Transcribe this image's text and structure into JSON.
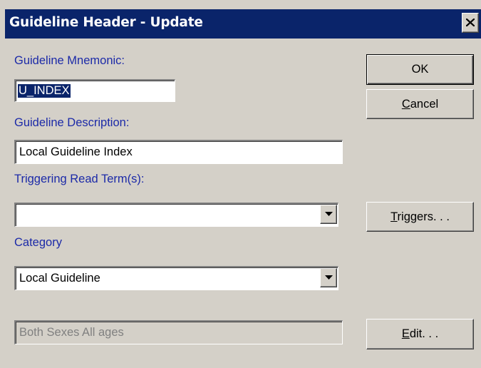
{
  "window": {
    "title": "Guideline Header - Update"
  },
  "fields": {
    "mnemonic_label": "Guideline Mnemonic:",
    "mnemonic_value": "U_INDEX",
    "description_label": "Guideline Description:",
    "description_value": "Local Guideline Index",
    "triggering_label": "Triggering Read Term(s):",
    "triggering_value": "",
    "category_label": "Category",
    "category_value": "Local Guideline",
    "population_value": "Both Sexes All ages"
  },
  "buttons": {
    "ok": "OK",
    "cancel_mnemonic": "C",
    "cancel_rest": "ancel",
    "triggers_mnemonic": "T",
    "triggers_rest": "riggers. . .",
    "edit_mnemonic": "E",
    "edit_rest": "dit. . ."
  },
  "icons": {
    "close": "close-icon",
    "dropdown": "chevron-down-icon"
  },
  "colors": {
    "title_bar": "#0a246a",
    "dialog_bg": "#d4d0c8",
    "label_text": "#1c2aa8",
    "selection_bg": "#0a246a"
  }
}
